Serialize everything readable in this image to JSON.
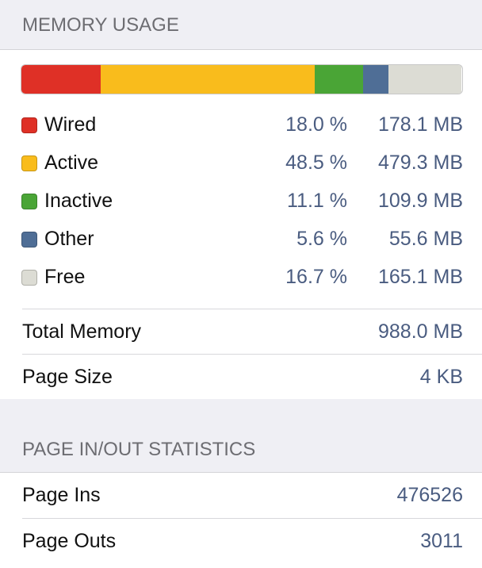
{
  "memory_usage": {
    "title": "MEMORY USAGE",
    "segments": [
      {
        "name": "Wired",
        "percent": "18.0 %",
        "size": "178.1 MB",
        "fraction": 18.0,
        "color": "#df3026"
      },
      {
        "name": "Active",
        "percent": "48.5 %",
        "size": "479.3 MB",
        "fraction": 48.5,
        "color": "#f9bc1c"
      },
      {
        "name": "Inactive",
        "percent": "11.1 %",
        "size": "109.9 MB",
        "fraction": 11.1,
        "color": "#4aa536"
      },
      {
        "name": "Other",
        "percent": "5.6 %",
        "size": "55.6 MB",
        "fraction": 5.6,
        "color": "#4f6e96"
      },
      {
        "name": "Free",
        "percent": "16.7 %",
        "size": "165.1 MB",
        "fraction": 16.7,
        "color": "#dcdcd4"
      }
    ],
    "total_label": "Total Memory",
    "total_value": "988.0 MB",
    "page_size_label": "Page Size",
    "page_size_value": "4 KB"
  },
  "page_stats": {
    "title": "PAGE IN/OUT STATISTICS",
    "page_ins_label": "Page Ins",
    "page_ins_value": "476526",
    "page_outs_label": "Page Outs",
    "page_outs_value": "3011"
  }
}
